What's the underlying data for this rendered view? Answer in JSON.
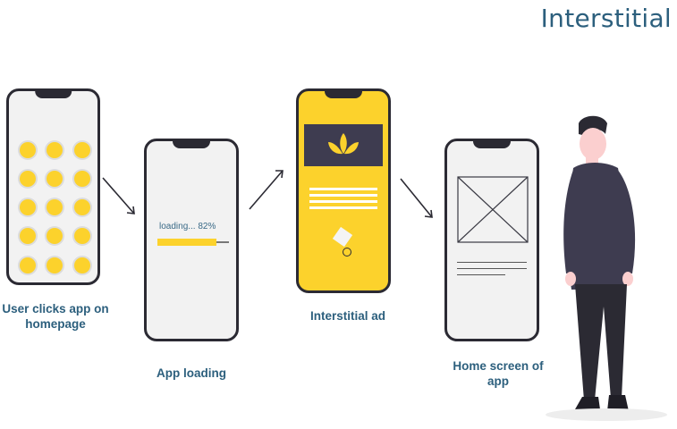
{
  "page_title": "Interstitial",
  "steps": [
    {
      "caption": "User clicks app on homepage"
    },
    {
      "caption": "App loading",
      "loading_text": "loading... 82%",
      "progress": 0.82
    },
    {
      "caption": "Interstitial ad"
    },
    {
      "caption": "Home screen of app"
    }
  ],
  "colors": {
    "accent": "#fcd22c",
    "title": "#2c5f7d",
    "phone_frame": "#2b2a33",
    "screen": "#f2f2f2",
    "ad_banner": "#3e3c50"
  }
}
